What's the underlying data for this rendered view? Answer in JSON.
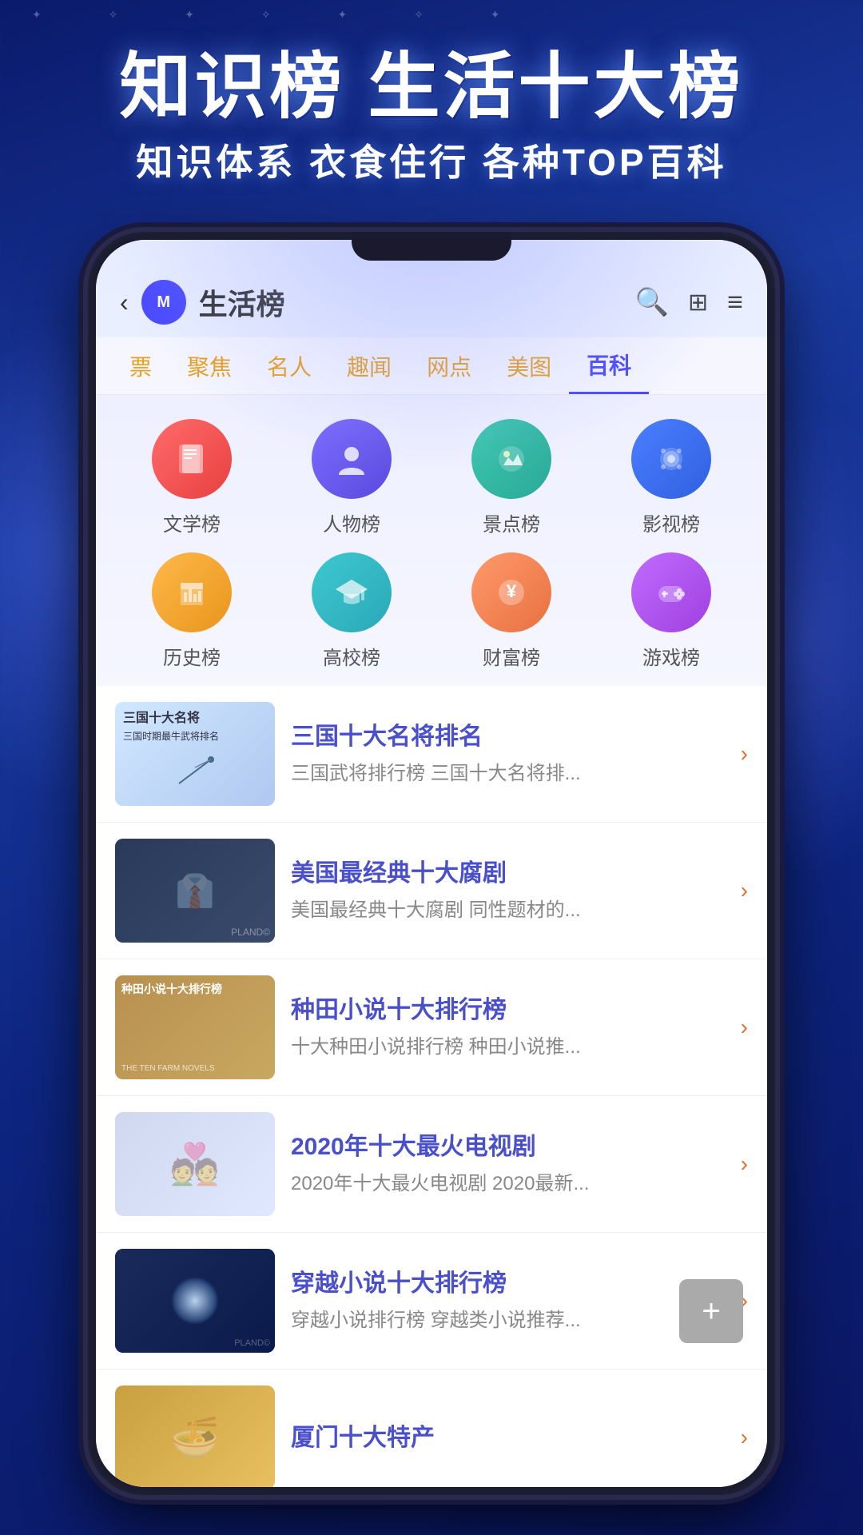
{
  "header": {
    "title_main": "知识榜 生活十大榜",
    "title_sub": "知识体系 衣食住行 各种TOP百科"
  },
  "topbar": {
    "back_label": "‹",
    "logo_text": "M",
    "title": "生活榜",
    "search_icon": "🔍",
    "grid_icon": "⊞",
    "menu_icon": "☰"
  },
  "nav_tabs": [
    {
      "label": "票",
      "active": false
    },
    {
      "label": "聚焦",
      "active": false
    },
    {
      "label": "名人",
      "active": false
    },
    {
      "label": "趣闻",
      "active": false
    },
    {
      "label": "网点",
      "active": false
    },
    {
      "label": "美图",
      "active": false
    },
    {
      "label": "百科",
      "active": true
    }
  ],
  "categories": [
    {
      "id": "wenxue",
      "label": "文学榜",
      "icon_class": "icon-wenxue",
      "icon": "📖"
    },
    {
      "id": "renwu",
      "label": "人物榜",
      "icon_class": "icon-renwu",
      "icon": "👤"
    },
    {
      "id": "jingdian",
      "label": "景点榜",
      "icon_class": "icon-jingdian",
      "icon": "🏔"
    },
    {
      "id": "yingshi",
      "label": "影视榜",
      "icon_class": "icon-yingshi",
      "icon": "🎬"
    },
    {
      "id": "lishi",
      "label": "历史榜",
      "icon_class": "icon-lishi",
      "icon": "📜"
    },
    {
      "id": "gaoxiao",
      "label": "高校榜",
      "icon_class": "icon-gaoxiao",
      "icon": "🎓"
    },
    {
      "id": "caifu",
      "label": "财富榜",
      "icon_class": "icon-caifu",
      "icon": "💹"
    },
    {
      "id": "youxi",
      "label": "游戏榜",
      "icon_class": "icon-youxi",
      "icon": "🎮"
    }
  ],
  "list_items": [
    {
      "id": 1,
      "thumb_label": "三国十大名将\n三国时期最牛武将排名",
      "title": "三国十大名将排名",
      "desc": "三国武将排行榜 三国十大名将排..."
    },
    {
      "id": 2,
      "thumb_label": "",
      "title": "美国最经典十大腐剧",
      "desc": "美国最经典十大腐剧 同性题材的..."
    },
    {
      "id": 3,
      "thumb_label": "种田小说十大排行榜",
      "title": "种田小说十大排行榜",
      "desc": "十大种田小说排行榜 种田小说推..."
    },
    {
      "id": 4,
      "thumb_label": "",
      "title": "2020年十大最火电视剧",
      "desc": "2020年十大最火电视剧 2020最新..."
    },
    {
      "id": 5,
      "thumb_label": "",
      "title": "穿越小说十大排行榜",
      "desc": "穿越小说排行榜 穿越类小说推荐..."
    },
    {
      "id": 6,
      "thumb_label": "",
      "title": "厦门十大特产",
      "desc": ""
    }
  ],
  "float_btn_label": "+"
}
